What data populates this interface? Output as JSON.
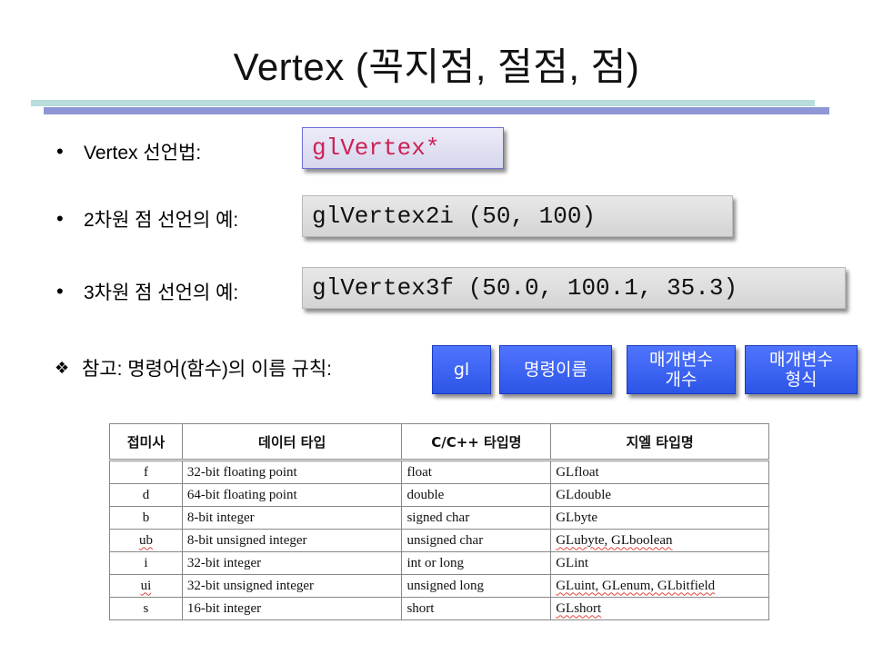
{
  "slide": {
    "title": "Vertex (꼭지점, 절점, 점)"
  },
  "bullets": [
    {
      "label": "Vertex 선언법:",
      "code": "glVertex*"
    },
    {
      "label": "2차원 점 선언의 예:",
      "code": "glVertex2i (50, 100)"
    },
    {
      "label": "3차원 점 선언의 예:",
      "code": "glVertex3f (50.0, 100.1, 35.3)"
    }
  ],
  "note": {
    "label": "참고: 명령어(함수)의 이름 규칙:",
    "parts": [
      {
        "line1": "gl",
        "line2": ""
      },
      {
        "line1": "명령이름",
        "line2": ""
      },
      {
        "line1": "매개변수",
        "line2": "개수"
      },
      {
        "line1": "매개변수",
        "line2": "형식"
      }
    ]
  },
  "table": {
    "headers": [
      "접미사",
      "데이터 타입",
      "C/C++ 타입명",
      "지엘 타입명"
    ],
    "rows": [
      [
        "f",
        "32-bit floating point",
        "float",
        "GLfloat"
      ],
      [
        "d",
        "64-bit floating point",
        "double",
        "GLdouble"
      ],
      [
        "b",
        "8-bit integer",
        "signed char",
        "GLbyte"
      ],
      [
        "ub",
        "8-bit unsigned integer",
        "unsigned char",
        "GLubyte, GLboolean"
      ],
      [
        "i",
        "32-bit integer",
        "int or long",
        "GLint"
      ],
      [
        "ui",
        "32-bit unsigned integer",
        "unsigned long",
        "GLuint, GLenum, GLbitfield"
      ],
      [
        "s",
        "16-bit integer",
        "short",
        "GLshort"
      ]
    ]
  },
  "colors": {
    "code_pink_text": "#cc2255",
    "blue_box": "#3a5ff0",
    "rule_light": "#b9dcdc",
    "rule_dark": "#8f96d6"
  }
}
